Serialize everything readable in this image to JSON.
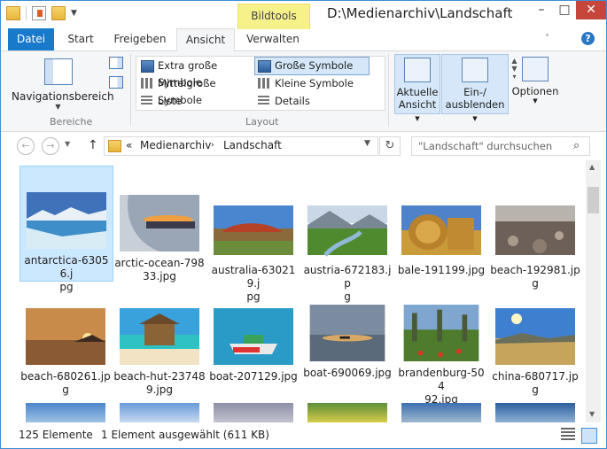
{
  "window": {
    "title": "D:\\Medienarchiv\\Landschaft",
    "contextual_tab": "Bildtools"
  },
  "tabs": {
    "file": "Datei",
    "start": "Start",
    "share": "Freigeben",
    "view": "Ansicht",
    "manage": "Verwalten"
  },
  "ribbon": {
    "panes": {
      "nav_pane": "Navigationsbereich",
      "group_label": "Bereiche"
    },
    "layout": {
      "group_label": "Layout",
      "options": [
        "Extra große Symbole",
        "Große Symbole",
        "Mittelgroße Symbole",
        "Kleine Symbole",
        "Liste",
        "Details"
      ],
      "selected": "Große Symbole"
    },
    "current_view": {
      "line1": "Aktuelle",
      "line2": "Ansicht"
    },
    "show_hide": {
      "line1": "Ein-/",
      "line2": "ausblenden"
    },
    "options": "Optionen"
  },
  "address": {
    "crumbs": [
      "Medienarchiv",
      "Landschaft"
    ],
    "prefix": "«",
    "search_placeholder": "\"Landschaft\" durchsuchen"
  },
  "files": [
    {
      "name": "antarctica-63056.jpg",
      "selected": true
    },
    {
      "name": "arctic-ocean-79833.jpg",
      "selected": false
    },
    {
      "name": "australia-630219.jpg",
      "selected": false
    },
    {
      "name": "austria-672183.jpg",
      "selected": false
    },
    {
      "name": "bale-191199.jpg",
      "selected": false
    },
    {
      "name": "beach-192981.jpg",
      "selected": false
    },
    {
      "name": "beach-680261.jpg",
      "selected": false
    },
    {
      "name": "beach-hut-237489.jpg",
      "selected": false
    },
    {
      "name": "boat-207129.jpg",
      "selected": false
    },
    {
      "name": "boat-690069.jpg",
      "selected": false
    },
    {
      "name": "brandenburg-50492.jpg",
      "selected": false
    },
    {
      "name": "china-680717.jpg",
      "selected": false
    }
  ],
  "file_display": [
    [
      "antarctica-63056.j",
      "pg"
    ],
    [
      "arctic-ocean-798",
      "33.jpg"
    ],
    [
      "australia-630219.j",
      "pg"
    ],
    [
      "austria-672183.jp",
      "g"
    ],
    [
      "bale-191199.jpg"
    ],
    [
      "beach-192981.jpg"
    ],
    [
      "beach-680261.jpg"
    ],
    [
      "beach-hut-23748",
      "9.jpg"
    ],
    [
      "boat-207129.jpg"
    ],
    [
      "boat-690069.jpg"
    ],
    [
      "brandenburg-504",
      "92.jpg"
    ],
    [
      "china-680717.jpg"
    ]
  ],
  "status": {
    "count": "125 Elemente",
    "selection": "1 Element ausgewählt (611 KB)"
  }
}
